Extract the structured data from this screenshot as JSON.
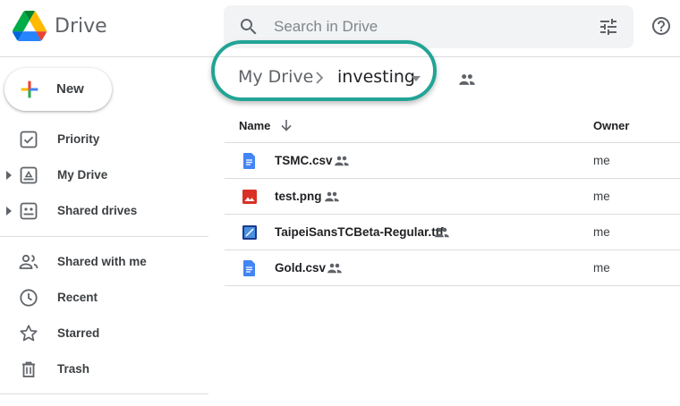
{
  "app": {
    "title": "Drive"
  },
  "search": {
    "placeholder": "Search in Drive"
  },
  "new_button": {
    "label": "New"
  },
  "sidebar": {
    "items": [
      {
        "label": "Priority",
        "icon": "priority-icon"
      },
      {
        "label": "My Drive",
        "icon": "my-drive-icon"
      },
      {
        "label": "Shared drives",
        "icon": "shared-drives-icon"
      },
      {
        "label": "Shared with me",
        "icon": "people-icon"
      },
      {
        "label": "Recent",
        "icon": "clock-icon"
      },
      {
        "label": "Starred",
        "icon": "star-icon"
      },
      {
        "label": "Trash",
        "icon": "trash-icon"
      }
    ]
  },
  "breadcrumb": {
    "root": "My Drive",
    "current": "investing"
  },
  "file_list": {
    "columns": {
      "name": "Name",
      "owner": "Owner"
    },
    "rows": [
      {
        "name": "TSMC.csv",
        "type": "document",
        "shared": true,
        "owner": "me"
      },
      {
        "name": "test.png",
        "type": "image",
        "shared": true,
        "owner": "me"
      },
      {
        "name": "TaipeiSansTCBeta-Regular.ttf",
        "type": "font",
        "shared": true,
        "owner": "me"
      },
      {
        "name": "Gold.csv",
        "type": "document",
        "shared": true,
        "owner": "me"
      }
    ]
  },
  "colors": {
    "highlight": "#21a495",
    "doc_blue": "#4285f4",
    "image_red": "#d93025",
    "font_blue": "#1a73e8"
  }
}
